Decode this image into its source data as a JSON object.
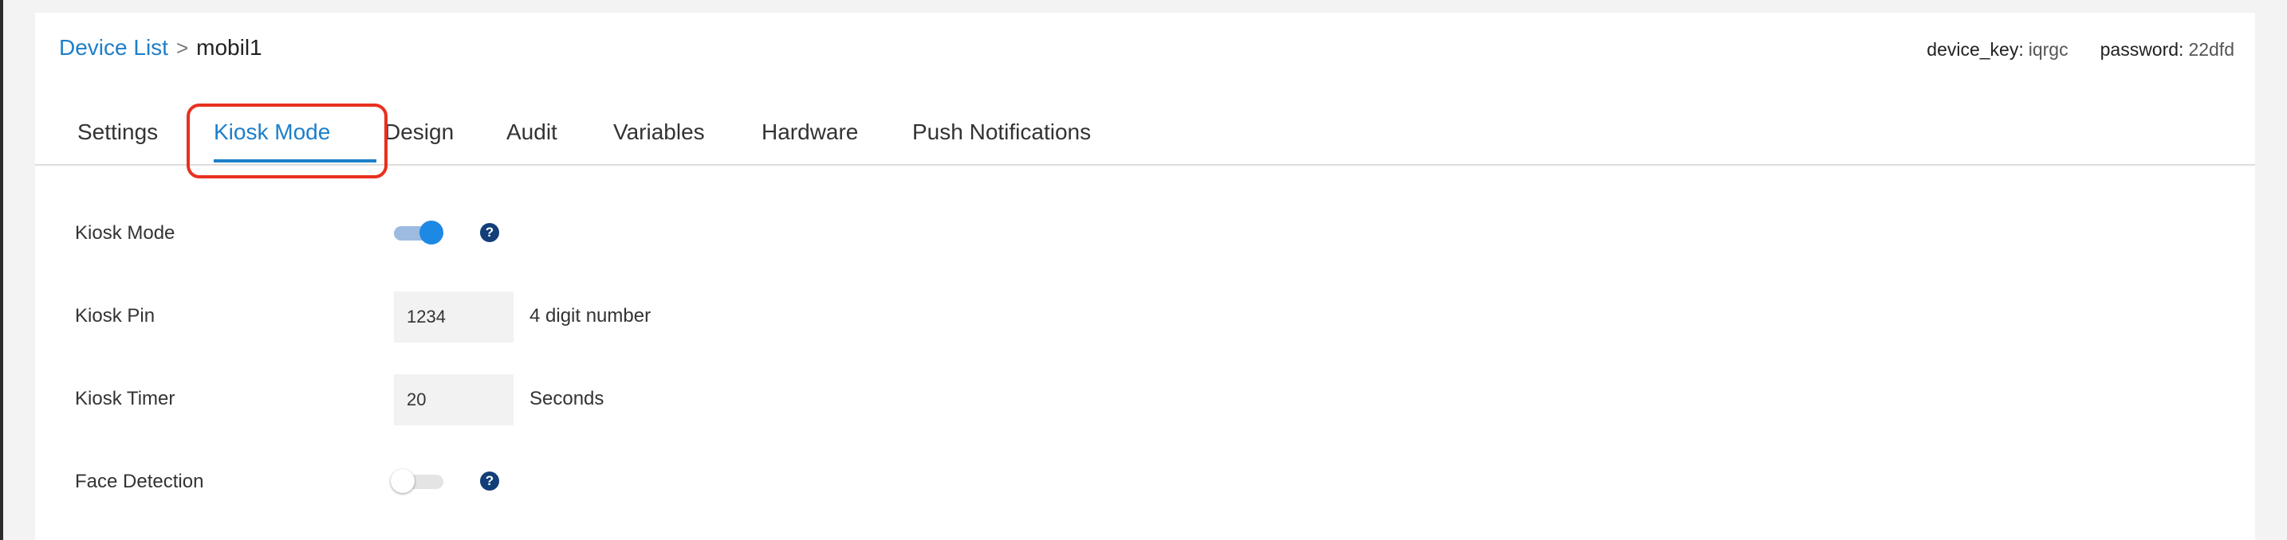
{
  "breadcrumb": {
    "root": "Device List",
    "separator": ">",
    "current": "mobil1"
  },
  "credentials": {
    "device_key_label": "device_key:",
    "device_key_value": "iqrgc",
    "password_label": "password:",
    "password_value": "22dfd"
  },
  "tabs": [
    {
      "label": "Settings",
      "active": false
    },
    {
      "label": "Kiosk Mode",
      "active": true
    },
    {
      "label": "Design",
      "active": false
    },
    {
      "label": "Audit",
      "active": false
    },
    {
      "label": "Variables",
      "active": false
    },
    {
      "label": "Hardware",
      "active": false
    },
    {
      "label": "Push Notifications",
      "active": false
    }
  ],
  "form": {
    "kiosk_mode": {
      "label": "Kiosk Mode",
      "enabled": true,
      "help_icon": "question-circle-icon",
      "help_glyph": "?"
    },
    "kiosk_pin": {
      "label": "Kiosk Pin",
      "value": "1234",
      "hint": "4 digit number"
    },
    "kiosk_timer": {
      "label": "Kiosk Timer",
      "value": "20",
      "hint": "Seconds"
    },
    "face_detection": {
      "label": "Face Detection",
      "enabled": false,
      "help_icon": "question-circle-icon",
      "help_glyph": "?"
    }
  },
  "colors": {
    "accent": "#1d7fc9",
    "highlight_outline": "#e8301f",
    "toggle_on": "#1e88e5",
    "help_icon": "#123e7a"
  }
}
